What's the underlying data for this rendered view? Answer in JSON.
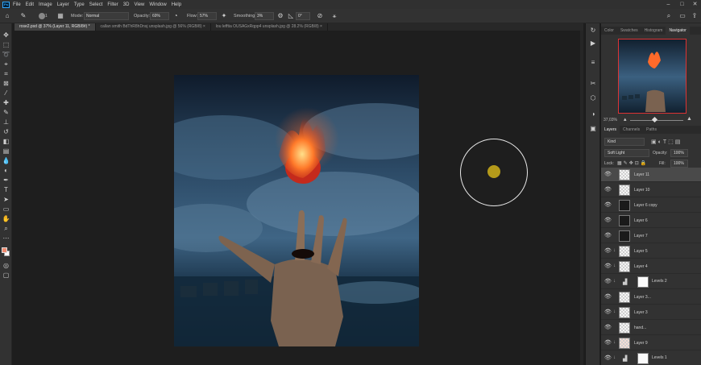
{
  "app": {
    "menu": [
      "File",
      "Edit",
      "Image",
      "Layer",
      "Type",
      "Select",
      "Filter",
      "3D",
      "View",
      "Window",
      "Help"
    ],
    "window_controls": [
      "–",
      "□",
      "✕"
    ]
  },
  "options_bar": {
    "mode_label": "Mode:",
    "mode_value": "Normal",
    "opacity_label": "Opacity:",
    "opacity_value": "69%",
    "flow_label": "Flow:",
    "flow_value": "57%",
    "smoothing_label": "Smoothing:",
    "smoothing_value": "3%",
    "angle_value": "0°",
    "brush_size": "1"
  },
  "tabs": [
    {
      "label": "rose2.psd @ 37% (Layer 11, RGB/8#) *",
      "active": true
    },
    {
      "label": "callan smith BdThR8hDnsj unsplash.jpg @ 56% (RGB/8) ×",
      "active": false
    },
    {
      "label": "lou lefftia OUSAGxRqpp4 unsplash.jpg @ 28.2% (RGB/8) ×",
      "active": false
    }
  ],
  "navigator": {
    "tabs": [
      "Color",
      "Swatches",
      "Histogram",
      "Navigator"
    ],
    "active_tab": "Navigator",
    "zoom": "37,03%"
  },
  "layers_panel": {
    "tabs": [
      "Layers",
      "Channels",
      "Paths"
    ],
    "active_tab": "Layers",
    "kind_label": "Kind",
    "blend_mode": "Soft Light",
    "opacity_label": "Opacity:",
    "opacity_value": "100%",
    "lock_label": "Lock:",
    "fill_label": "Fill:",
    "fill_value": "100%",
    "layers": [
      {
        "name": "Layer 11",
        "thumb": "checker",
        "selected": true,
        "clipped": false
      },
      {
        "name": "Layer 10",
        "thumb": "checker",
        "selected": false,
        "clipped": false
      },
      {
        "name": "Layer 6 copy",
        "thumb": "dark",
        "selected": false,
        "clipped": false
      },
      {
        "name": "Layer 6",
        "thumb": "dark",
        "selected": false,
        "clipped": false
      },
      {
        "name": "Layer 7",
        "thumb": "dark",
        "selected": false,
        "clipped": false
      },
      {
        "name": "Layer 5",
        "thumb": "checker",
        "selected": false,
        "clipped": true
      },
      {
        "name": "Layer 4",
        "thumb": "checker",
        "selected": false,
        "clipped": true
      },
      {
        "name": "Levels 2",
        "thumb": "adjust",
        "selected": false,
        "clipped": true
      },
      {
        "name": "Layer 3...",
        "thumb": "checker",
        "selected": false,
        "clipped": false
      },
      {
        "name": "Layer 3",
        "thumb": "checker",
        "selected": false,
        "clipped": true
      },
      {
        "name": "hand...",
        "thumb": "checker",
        "selected": false,
        "clipped": false
      },
      {
        "name": "Layer 9",
        "thumb": "rose",
        "selected": false,
        "clipped": true
      },
      {
        "name": "Levels 1",
        "thumb": "adjust",
        "selected": false,
        "clipped": true
      }
    ]
  },
  "colors": {
    "foreground": "#f08a6e",
    "background": "#ffffff",
    "brush_preview": "#b49a1a"
  }
}
